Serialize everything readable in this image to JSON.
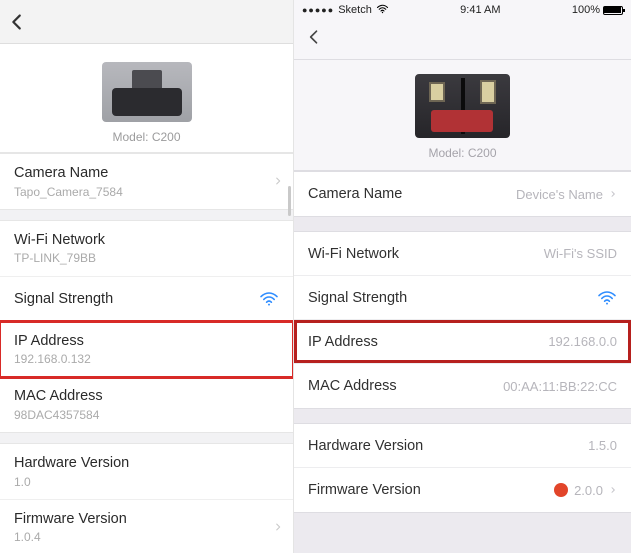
{
  "left": {
    "model_label": "Model: C200",
    "camera_name": {
      "label": "Camera Name",
      "value": "Tapo_Camera_7584"
    },
    "wifi": {
      "label": "Wi-Fi Network",
      "value": "TP-LINK_79BB"
    },
    "signal": {
      "label": "Signal Strength"
    },
    "ip": {
      "label": "IP Address",
      "value": "192.168.0.132"
    },
    "mac": {
      "label": "MAC Address",
      "value": "98DAC4357584"
    },
    "hw": {
      "label": "Hardware Version",
      "value": "1.0"
    },
    "fw": {
      "label": "Firmware Version",
      "value": "1.0.4"
    }
  },
  "right": {
    "status": {
      "carrier": "Sketch",
      "time": "9:41 AM",
      "battery": "100%"
    },
    "model_label": "Model: C200",
    "camera_name": {
      "label": "Camera Name",
      "value": "Device's Name"
    },
    "wifi": {
      "label": "Wi-Fi Network",
      "value": "Wi-Fi's SSID"
    },
    "signal": {
      "label": "Signal Strength"
    },
    "ip": {
      "label": "IP Address",
      "value": "192.168.0.0"
    },
    "mac": {
      "label": "MAC Address",
      "value": "00:AA:11:BB:22:CC"
    },
    "hw": {
      "label": "Hardware Version",
      "value": "1.5.0"
    },
    "fw": {
      "label": "Firmware Version",
      "value": "2.0.0"
    }
  }
}
